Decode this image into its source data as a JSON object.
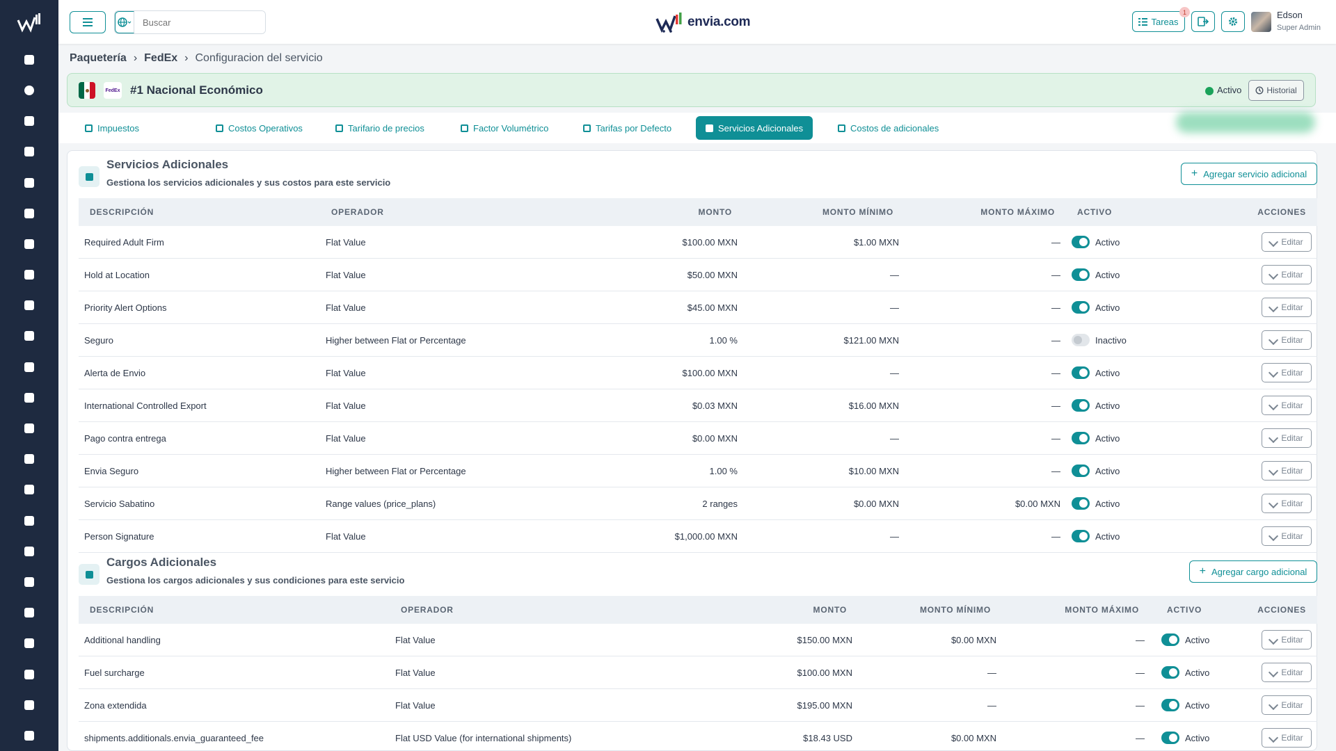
{
  "sidebar": {
    "items": [
      "dashboard-icon",
      "orders-icon",
      "packages-icon",
      "truck-icon",
      "calendar-icon",
      "bag-icon",
      "money-icon",
      "document-icon",
      "file-icon",
      "card-icon",
      "cash-icon",
      "invoice-icon",
      "store-icon",
      "users-icon",
      "id-card-icon",
      "signature-icon",
      "list-icon",
      "report-icon",
      "delivery-icon",
      "doc-icon",
      "list2-icon",
      "file2-icon",
      "circle-icon"
    ]
  },
  "topbar": {
    "search_placeholder": "Buscar",
    "brand": "envia.com",
    "tasks_label": "Tareas",
    "tasks_badge": "1",
    "user_name": "Edson",
    "user_role": "Super Admin"
  },
  "breadcrumb": {
    "items": [
      "Paquetería",
      "FedEx",
      "Configuracion del servicio"
    ]
  },
  "service": {
    "carrier_logo": "FedEx",
    "title": "#1 Nacional Económico",
    "status": "Activo",
    "history_label": "Historial"
  },
  "tabs": [
    {
      "label": "Impuestos",
      "active": false
    },
    {
      "label": "Costos Operativos",
      "active": false
    },
    {
      "label": "Tarifario de precios",
      "active": false
    },
    {
      "label": "Factor Volumétrico",
      "active": false
    },
    {
      "label": "Tarifas por Defecto",
      "active": false
    },
    {
      "label": "Servicios Adicionales",
      "active": true
    },
    {
      "label": "Costos de adicionales",
      "active": false
    }
  ],
  "additional_services": {
    "title": "Servicios Adicionales",
    "subtitle": "Gestiona los servicios adicionales y sus costos para este servicio",
    "add_label": "Agregar servicio adicional",
    "columns": [
      "Descripción",
      "Operador",
      "Monto",
      "Monto Mínimo",
      "Monto Máximo",
      "Activo",
      "Acciones"
    ],
    "rows": [
      {
        "desc": "Required Adult Firm",
        "op": "Flat Value",
        "amount": "$100.00 MXN",
        "min": "$1.00 MXN",
        "max": "—",
        "active": true,
        "status": "Activo"
      },
      {
        "desc": "Hold at Location",
        "op": "Flat Value",
        "amount": "$50.00 MXN",
        "min": "—",
        "max": "—",
        "active": true,
        "status": "Activo"
      },
      {
        "desc": "Priority Alert Options",
        "op": "Flat Value",
        "amount": "$45.00 MXN",
        "min": "—",
        "max": "—",
        "active": true,
        "status": "Activo"
      },
      {
        "desc": "Seguro",
        "op": "Higher between Flat or Percentage",
        "amount": "1.00 %",
        "min": "$121.00 MXN",
        "max": "—",
        "active": false,
        "status": "Inactivo"
      },
      {
        "desc": "Alerta de Envio",
        "op": "Flat Value",
        "amount": "$100.00 MXN",
        "min": "—",
        "max": "—",
        "active": true,
        "status": "Activo"
      },
      {
        "desc": "International Controlled Export",
        "op": "Flat Value",
        "amount": "$0.03 MXN",
        "min": "$16.00 MXN",
        "max": "—",
        "active": true,
        "status": "Activo"
      },
      {
        "desc": "Pago contra entrega",
        "op": "Flat Value",
        "amount": "$0.00 MXN",
        "min": "—",
        "max": "—",
        "active": true,
        "status": "Activo"
      },
      {
        "desc": "Envia Seguro",
        "op": "Higher between Flat or Percentage",
        "amount": "1.00 %",
        "min": "$10.00 MXN",
        "max": "—",
        "active": true,
        "status": "Activo"
      },
      {
        "desc": "Servicio Sabatino",
        "op": "Range values (price_plans)",
        "amount": "2 ranges",
        "min": "$0.00 MXN",
        "max": "$0.00 MXN",
        "active": true,
        "status": "Activo"
      },
      {
        "desc": "Person Signature",
        "op": "Flat Value",
        "amount": "$1,000.00 MXN",
        "min": "—",
        "max": "—",
        "active": true,
        "status": "Activo"
      }
    ],
    "edit_label": "Editar"
  },
  "additional_charges": {
    "title": "Cargos Adicionales",
    "subtitle": "Gestiona los cargos adicionales y sus condiciones para este servicio",
    "add_label": "Agregar cargo adicional",
    "columns": [
      "Descripción",
      "Operador",
      "Monto",
      "Monto Mínimo",
      "Monto Máximo",
      "Activo",
      "Acciones"
    ],
    "rows": [
      {
        "desc": "Additional handling",
        "op": "Flat Value",
        "amount": "$150.00 MXN",
        "min": "$0.00 MXN",
        "max": "—",
        "active": true,
        "status": "Activo"
      },
      {
        "desc": "Fuel surcharge",
        "op": "Flat Value",
        "amount": "$100.00 MXN",
        "min": "—",
        "max": "—",
        "active": true,
        "status": "Activo"
      },
      {
        "desc": "Zona extendida",
        "op": "Flat Value",
        "amount": "$195.00 MXN",
        "min": "—",
        "max": "—",
        "active": true,
        "status": "Activo"
      },
      {
        "desc": "shipments.additionals.envia_guaranteed_fee",
        "op": "Flat USD Value (for international shipments)",
        "amount": "$18.43 USD",
        "min": "$0.00 MXN",
        "max": "—",
        "active": true,
        "status": "Activo"
      }
    ],
    "edit_label": "Editar"
  }
}
